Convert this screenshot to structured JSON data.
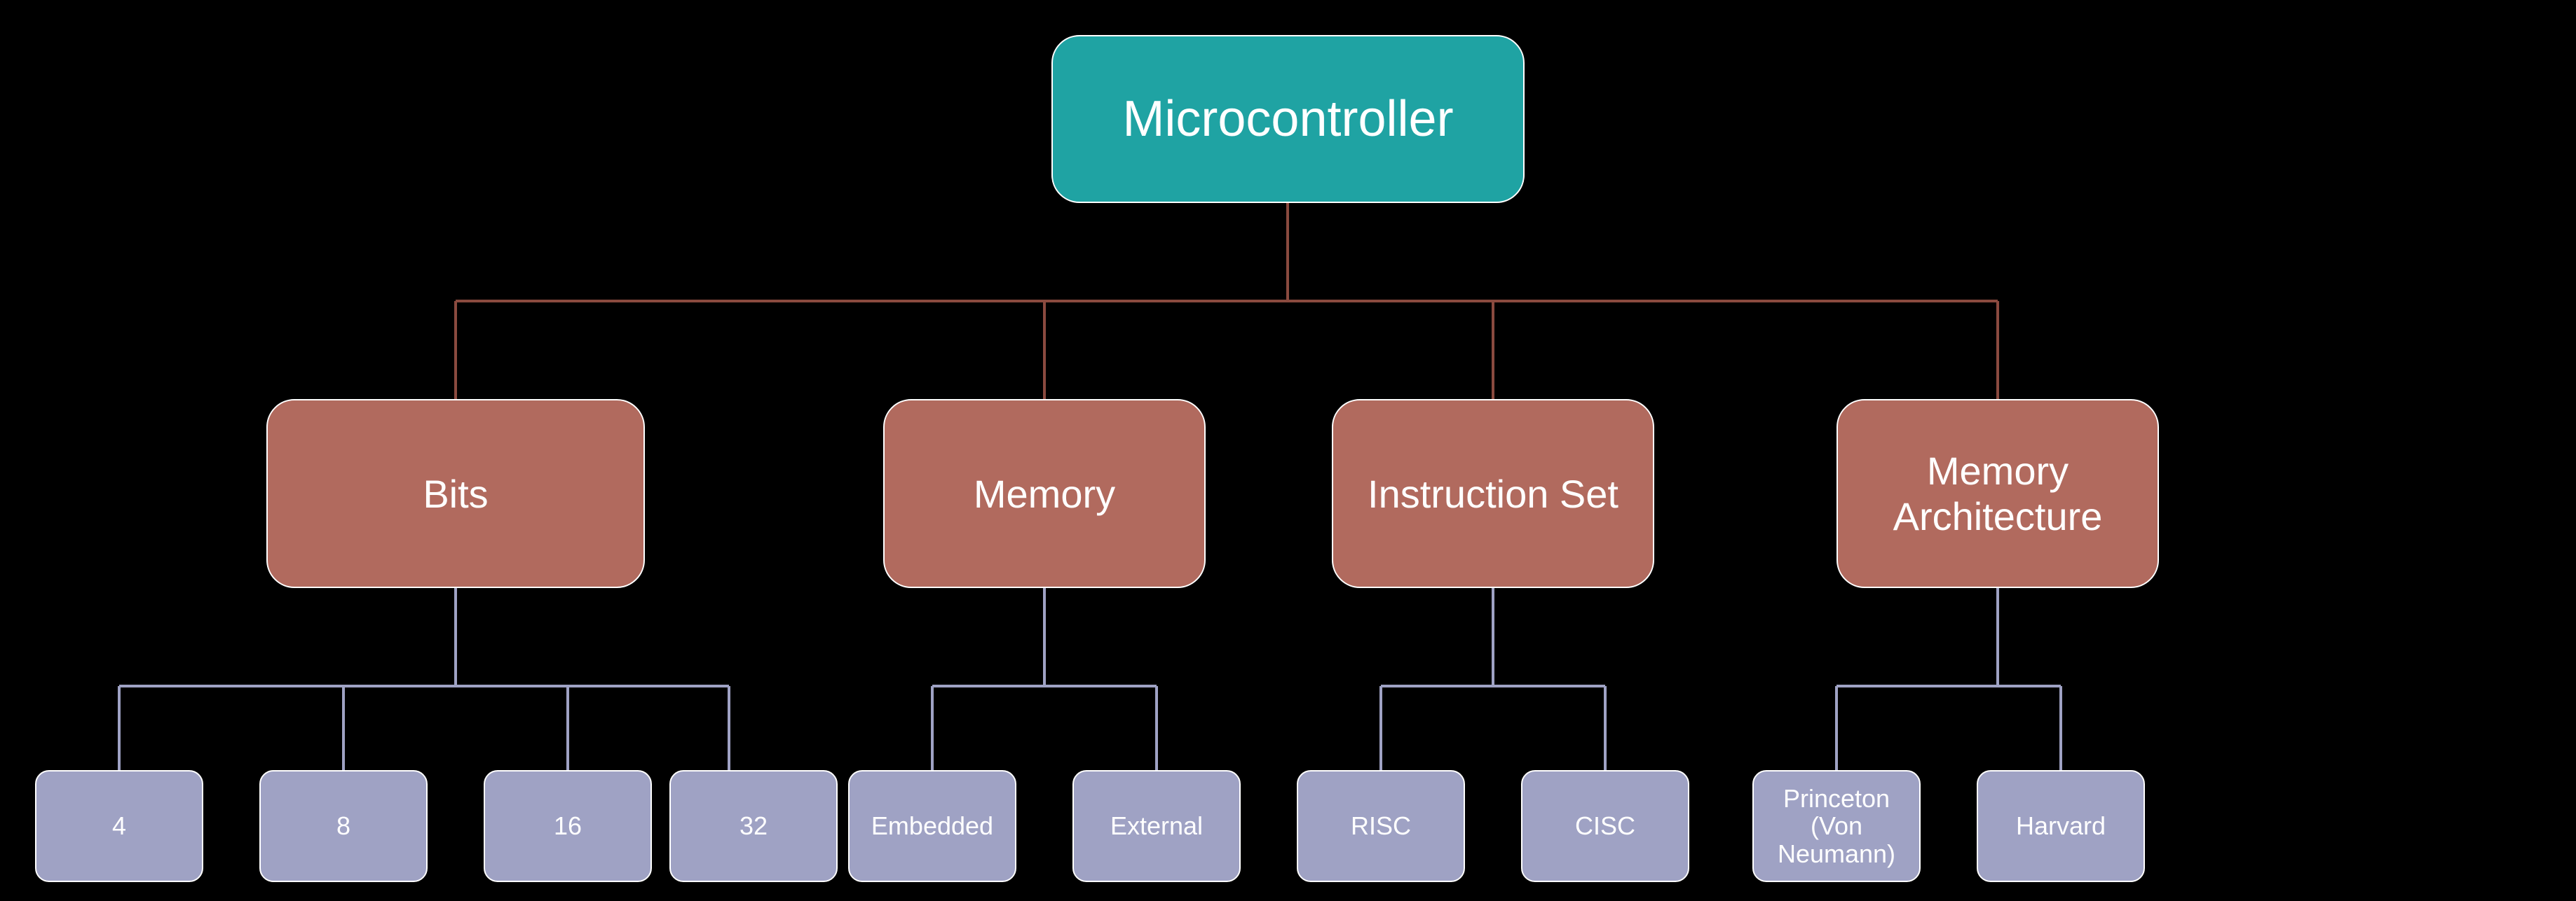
{
  "root": {
    "label": "Microcontroller"
  },
  "categories": [
    {
      "label": "Bits"
    },
    {
      "label": "Memory"
    },
    {
      "label": "Instruction Set"
    },
    {
      "label": "Memory Architecture"
    }
  ],
  "leaves": {
    "bits": [
      "4",
      "8",
      "16",
      "32"
    ],
    "memory": [
      "Embedded",
      "External"
    ],
    "instr": [
      "RISC",
      "CISC"
    ],
    "memarch": [
      "Princeton (Von Neumann)",
      "Harvard"
    ]
  },
  "colors": {
    "root_line": "#8a4a3f",
    "cat_line": "#9fa2c4"
  }
}
